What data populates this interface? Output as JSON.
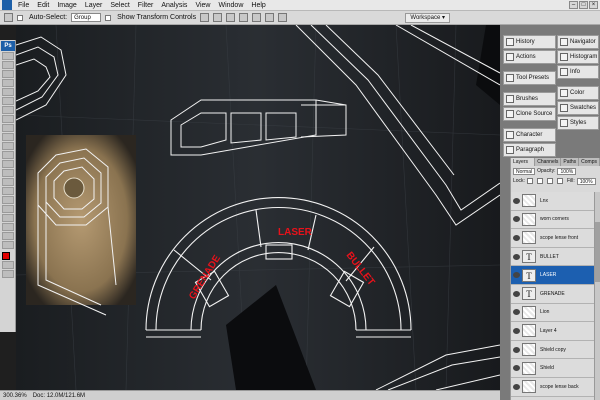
{
  "menu": {
    "items": [
      "File",
      "Edit",
      "Image",
      "Layer",
      "Select",
      "Filter",
      "Analysis",
      "View",
      "Window",
      "Help"
    ],
    "window_buttons": [
      "–",
      "□",
      "×"
    ]
  },
  "options_bar": {
    "auto_select_label": "Auto-Select:",
    "auto_select_value": "Group",
    "show_transform_label": "Show Transform Controls",
    "workspace_label": "Workspace ▾"
  },
  "toolbox": {
    "badge": "Ps",
    "foreground_color": "#e10000"
  },
  "panels": {
    "left": [
      {
        "icon": "history-icon",
        "label": "History"
      },
      {
        "icon": "actions-icon",
        "label": "Actions"
      },
      {
        "icon": "tool-presets-icon",
        "label": "Tool Presets"
      },
      {
        "icon": "brushes-icon",
        "label": "Brushes"
      },
      {
        "icon": "clone-source-icon",
        "label": "Clone Source"
      },
      {
        "icon": "character-icon",
        "label": "Character"
      },
      {
        "icon": "paragraph-icon",
        "label": "Paragraph"
      }
    ],
    "right": [
      {
        "icon": "navigator-icon",
        "label": "Navigator"
      },
      {
        "icon": "histogram-icon",
        "label": "Histogram"
      },
      {
        "icon": "info-icon",
        "label": "Info"
      },
      {
        "icon": "color-icon",
        "label": "Color"
      },
      {
        "icon": "swatches-icon",
        "label": "Swatches"
      },
      {
        "icon": "styles-icon",
        "label": "Styles"
      }
    ]
  },
  "layers_panel": {
    "tabs": [
      "Layers ×",
      "Channels",
      "Paths",
      "Comps"
    ],
    "blend_mode": "Normal",
    "opacity_label": "Opacity:",
    "opacity_value": "100%",
    "lock_label": "Lock:",
    "fill_label": "Fill:",
    "fill_value": "100%",
    "layers": [
      {
        "name": "Lnx",
        "type": "image",
        "selected": false
      },
      {
        "name": "worn corners",
        "type": "image",
        "selected": false
      },
      {
        "name": "scope lense front",
        "type": "image",
        "selected": false
      },
      {
        "name": "BULLET",
        "type": "text",
        "selected": false
      },
      {
        "name": "LASER",
        "type": "text",
        "selected": true
      },
      {
        "name": "GRENADE",
        "type": "text",
        "selected": false
      },
      {
        "name": "Lion",
        "type": "image",
        "selected": false
      },
      {
        "name": "Layer 4",
        "type": "image",
        "selected": false
      },
      {
        "name": "Shield copy",
        "type": "image",
        "selected": false
      },
      {
        "name": "Shield",
        "type": "image",
        "selected": false
      },
      {
        "name": "scope lense back",
        "type": "image",
        "selected": false
      }
    ]
  },
  "canvas": {
    "labels": {
      "laser": "LASER",
      "grenade": "GRENADE",
      "bullet": "BULLET"
    },
    "label_color": "#e8121b",
    "wire_color": "#f2f2f2"
  },
  "status": {
    "zoom": "300.36%",
    "doc": "Doc: 12.0M/121.6M"
  }
}
